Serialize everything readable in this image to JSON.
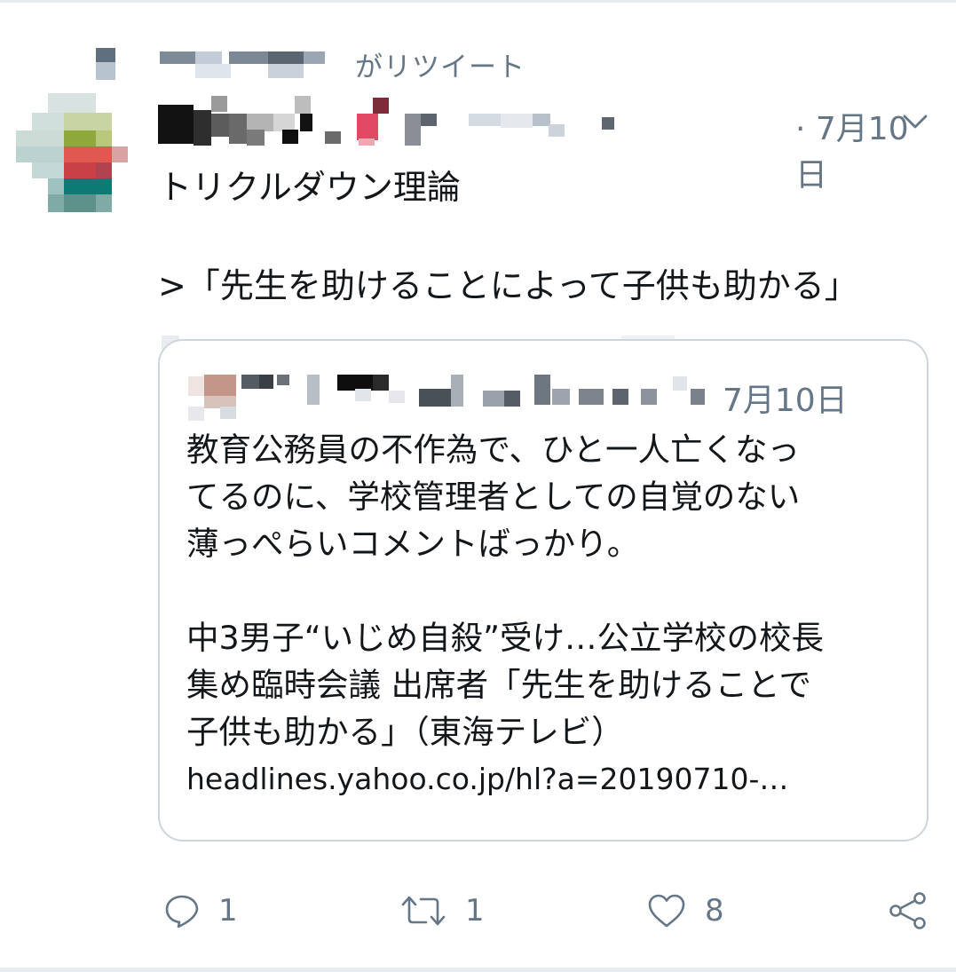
{
  "retweet_label": "がリツイート",
  "tweet": {
    "date": "· 7月10日",
    "text_line1": "トリクルダウン理論",
    "text_line2": ">「先生を助けることによって子供も助かる」"
  },
  "quoted_tweet": {
    "date": "7月10日",
    "lines": [
      "教育公務員の不作為で、ひと一人亡くなっ",
      "てるのに、学校管理者としての自覚のない",
      "薄っぺらいコメントばっかり。",
      "",
      "中3男子“いじめ自殺”受け…公立学校の校長",
      "集め臨時会議 出席者「先生を助けることで",
      "子供も助かる」（東海テレビ）"
    ],
    "link": "headlines.yahoo.co.jp/hl?a=20190710-…"
  },
  "actions": {
    "reply_count": "1",
    "retweet_count": "1",
    "like_count": "8"
  },
  "icons": {
    "caret": "chevron-down-icon",
    "reply": "reply-icon",
    "retweet": "retweet-icon",
    "like": "heart-icon",
    "share": "share-icon"
  }
}
